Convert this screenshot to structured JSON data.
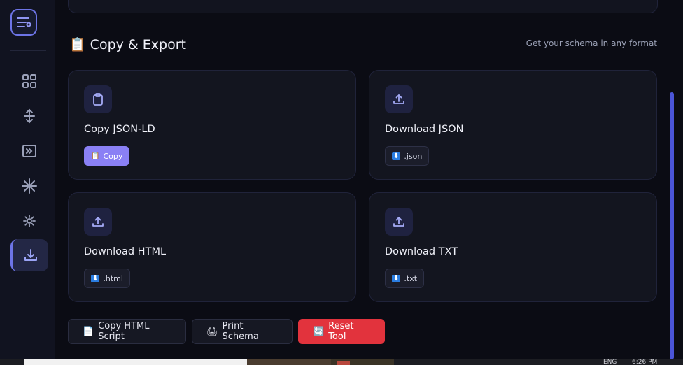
{
  "section": {
    "title": "Copy & Export",
    "title_glyph": "📋",
    "subtitle": "Get your schema in any format"
  },
  "cards": [
    {
      "title": "Copy JSON-LD",
      "icon": "clipboard-icon",
      "action_glyph": "📋",
      "action_label": "Copy",
      "style": "primary"
    },
    {
      "title": "Download JSON",
      "icon": "upload-tray-icon",
      "action_glyph": "⬇",
      "action_label": ".json",
      "style": "secondary"
    },
    {
      "title": "Download HTML",
      "icon": "upload-tray-icon",
      "action_glyph": "⬇",
      "action_label": ".html",
      "style": "secondary"
    },
    {
      "title": "Download TXT",
      "icon": "upload-tray-icon",
      "action_glyph": "⬇",
      "action_label": ".txt",
      "style": "secondary"
    }
  ],
  "footer_buttons": [
    {
      "glyph": "📄",
      "label": "Copy HTML Script"
    },
    {
      "glyph": "🖨",
      "label": "Print Schema"
    },
    {
      "glyph": "🔄",
      "label": "Reset Tool",
      "style": "danger"
    }
  ],
  "sidebar": {
    "items": [
      {
        "icon": "grid-icon"
      },
      {
        "icon": "move-vertical-icon"
      },
      {
        "icon": "forward-box-icon"
      },
      {
        "icon": "sparkle-icon"
      },
      {
        "icon": "settings-icon"
      },
      {
        "icon": "download-icon",
        "active": true
      }
    ]
  },
  "taskbar": {
    "lang": "ENG",
    "time": "6:26 PM"
  },
  "colors": {
    "accent": "#6d74e6",
    "primary_button": "#8a80f5",
    "danger_button": "#e2333d",
    "background": "#0b0c14",
    "card": "#13151f"
  }
}
